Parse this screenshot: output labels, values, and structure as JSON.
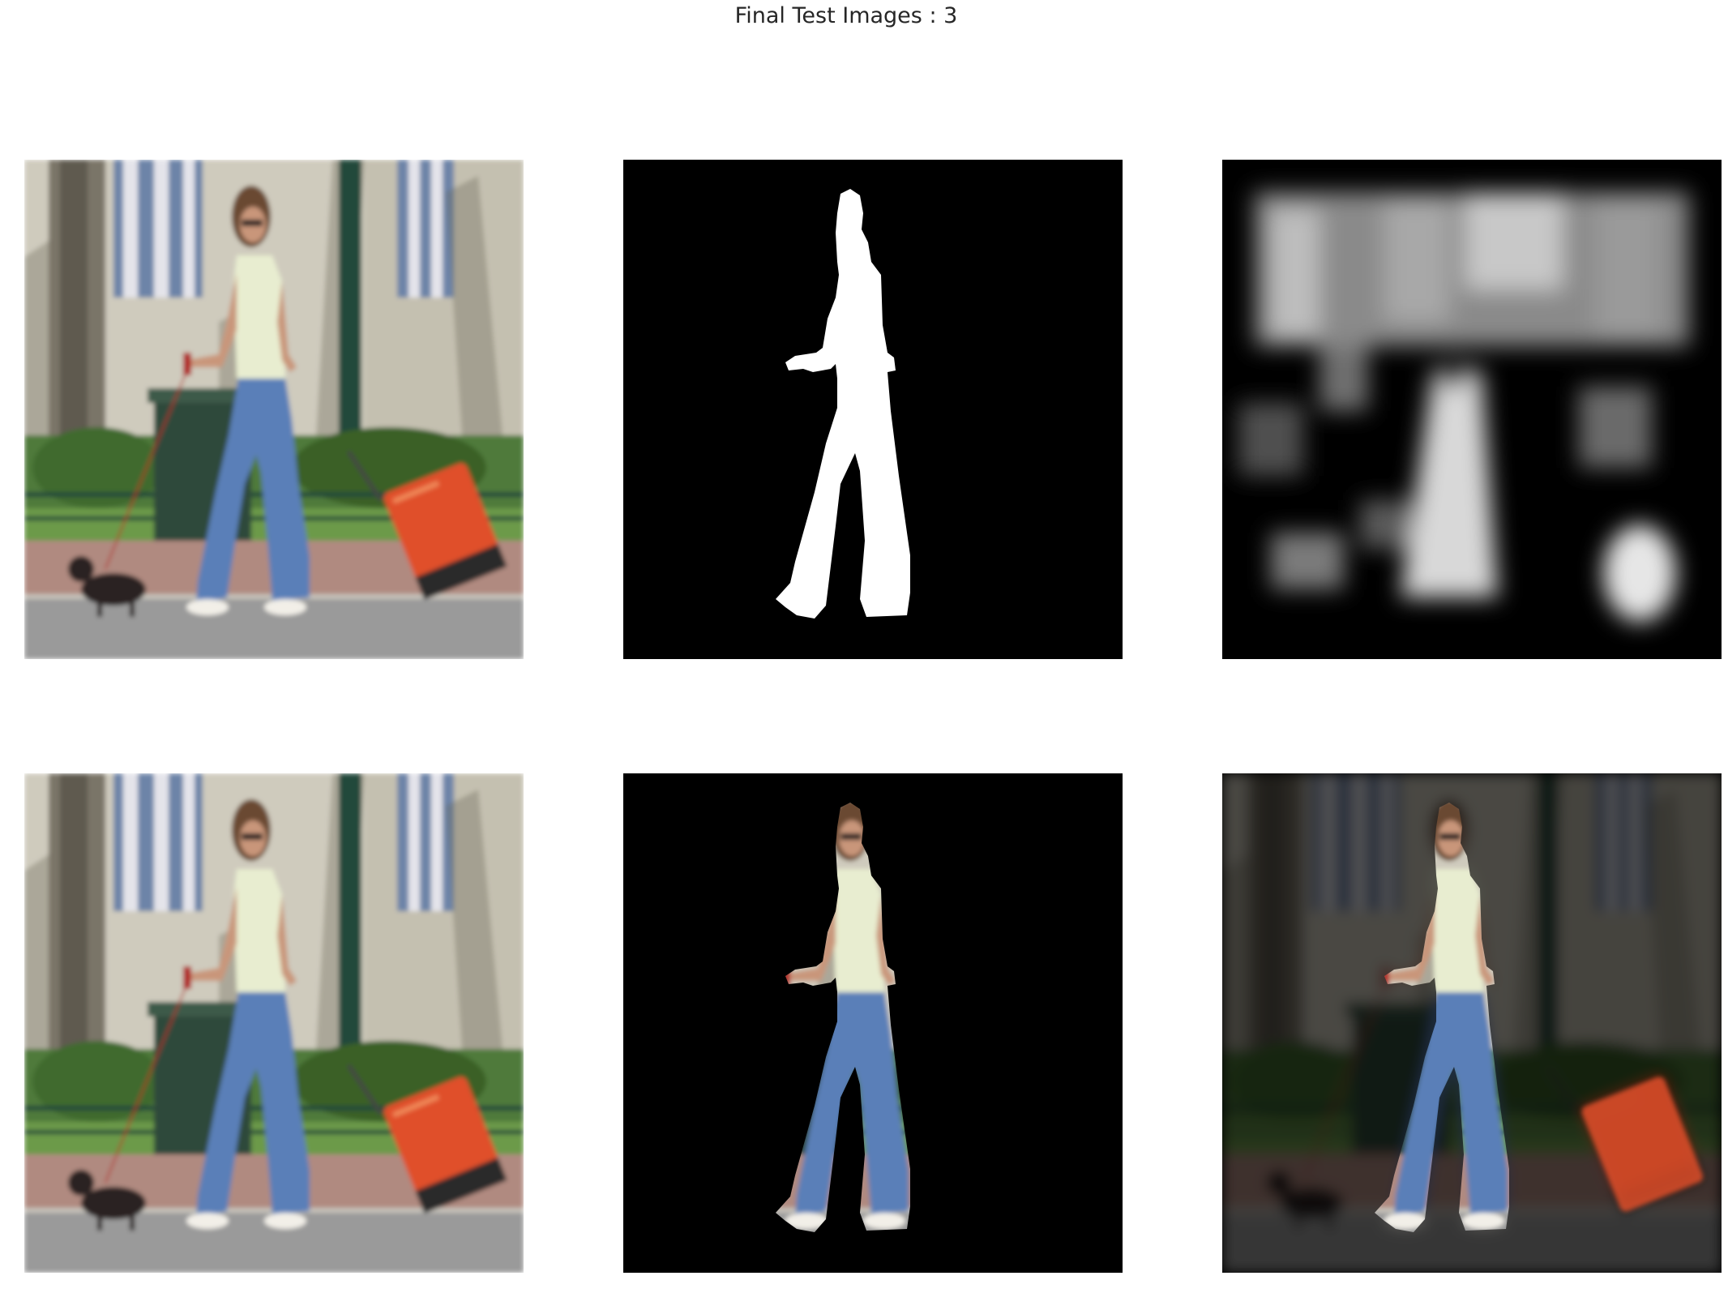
{
  "figure": {
    "title": "Final Test Images : 3"
  },
  "panels": [
    {
      "row": 1,
      "col": 1,
      "content": "original-photo"
    },
    {
      "row": 1,
      "col": 2,
      "content": "ground-truth-mask"
    },
    {
      "row": 1,
      "col": 3,
      "content": "predicted-mask"
    },
    {
      "row": 2,
      "col": 1,
      "content": "original-photo"
    },
    {
      "row": 2,
      "col": 2,
      "content": "ground-truth-masked-image"
    },
    {
      "row": 2,
      "col": 3,
      "content": "predicted-masked-image"
    }
  ],
  "colors": {
    "background": "#ffffff",
    "mask_black": "#000000",
    "mask_white": "#ffffff",
    "jeans": "#5a7fb8",
    "top": "#e8edd0",
    "skin": "#c9967a",
    "suitcase": "#e0502a",
    "trash_can": "#2f4a3a",
    "pole": "#24483a",
    "building": "#d6d2c4",
    "window": "#6d84a8",
    "grass": "#6c9a4a",
    "sidewalk": "#b08a80",
    "road": "#9a9a9a"
  }
}
